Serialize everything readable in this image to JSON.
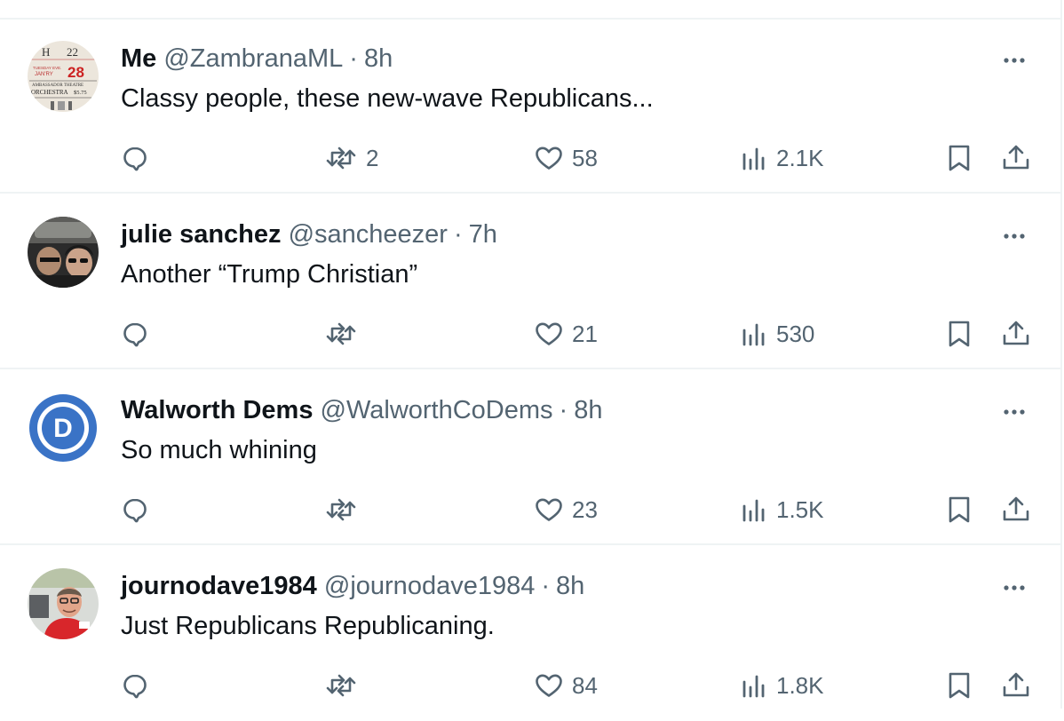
{
  "tweets": [
    {
      "name": "Me",
      "handle": "@ZambranaML",
      "separator": "·",
      "time": "8h",
      "text": "Classy people, these new-wave Republicans...",
      "avatar": "ticket-stub-avatar",
      "avatar_text": {
        "row": "H",
        "seat": "22",
        "day": "TUESDAY EVE.",
        "month": "JAN'RY",
        "date": "28",
        "venue": "AMBASSADOR THEATRE",
        "section": "ORCHESTRA",
        "price": "$5.75"
      },
      "replies": "",
      "reposts": "2",
      "likes": "58",
      "views": "2.1K"
    },
    {
      "name": "julie sanchez",
      "handle": "@sancheezer",
      "separator": "·",
      "time": "7h",
      "text": "Another “Trump Christian”",
      "avatar": "car-selfie-avatar",
      "replies": "",
      "reposts": "",
      "likes": "21",
      "views": "530"
    },
    {
      "name": "Walworth Dems",
      "handle": "@WalworthCoDems",
      "separator": "·",
      "time": "8h",
      "text": "So much whining",
      "avatar": "democrats-logo-avatar",
      "avatar_text": {
        "letter": "D"
      },
      "replies": "",
      "reposts": "",
      "likes": "23",
      "views": "1.5K"
    },
    {
      "name": "journodave1984",
      "handle": "@journodave1984",
      "separator": "·",
      "time": "8h",
      "text": "Just Republicans Republicaning.",
      "avatar": "man-in-red-shirt-avatar",
      "replies": "",
      "reposts": "",
      "likes": "84",
      "views": "1.8K"
    }
  ],
  "colors": {
    "text": "#0f1419",
    "secondary": "#536471",
    "border": "#eff3f4",
    "dems_blue": "#3a73c6"
  },
  "icons": [
    "reply-icon",
    "repost-icon",
    "like-icon",
    "views-icon",
    "bookmark-icon",
    "share-icon",
    "more-icon"
  ]
}
